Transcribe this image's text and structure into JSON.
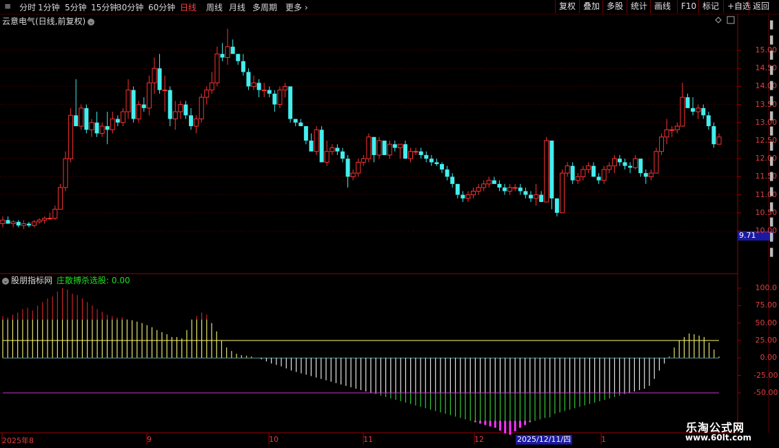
{
  "toolbar": {
    "periods": [
      "分时",
      "1分钟",
      "5分钟",
      "15分钟",
      "30分钟",
      "60分钟",
      "日线",
      "周线",
      "月线",
      "多周期",
      "更多"
    ],
    "active_period": "日线",
    "right_buttons": [
      "复权",
      "叠加",
      "多股",
      "统计",
      "画线",
      "F10",
      "标记",
      "+自选",
      "返回"
    ]
  },
  "main_chart": {
    "title": "云意电气(日线,前复权)",
    "price_tag": "9.71",
    "y_ticks": [
      "15.00",
      "14.50",
      "14.00",
      "13.50",
      "13.00",
      "12.50",
      "12.00",
      "11.50",
      "11.00",
      "10.50",
      "10.00"
    ]
  },
  "indicator": {
    "name": "股朋指标网",
    "formula_label": "庄散搏杀选股: 0.00",
    "y_ticks": [
      "100.0",
      "75.00",
      "50.00",
      "25.00",
      "0.00",
      "-25.00",
      "-50.00"
    ],
    "line_upper": 25,
    "line_lower": -50
  },
  "x_axis": {
    "labels": [
      "2025年8",
      "9",
      "10",
      "11",
      "12",
      "1"
    ],
    "cursor_date": "2025/12/11/四"
  },
  "watermark": {
    "line1": "乐淘公式网",
    "line2": "www.60lt.com"
  },
  "colors": {
    "up": "#ff3333",
    "down": "#44eeee",
    "yellow_line": "#ffff66",
    "magenta_line": "#cc33cc"
  },
  "chart_data": {
    "type": "candlestick",
    "candles": [
      [
        10.2,
        10.4,
        10.1,
        10.3
      ],
      [
        10.3,
        10.4,
        10.2,
        10.2
      ],
      [
        10.2,
        10.3,
        10.1,
        10.25
      ],
      [
        10.25,
        10.3,
        10.1,
        10.15
      ],
      [
        10.15,
        10.3,
        10.05,
        10.2
      ],
      [
        10.2,
        10.25,
        10.1,
        10.15
      ],
      [
        10.15,
        10.3,
        10.1,
        10.25
      ],
      [
        10.25,
        10.35,
        10.2,
        10.3
      ],
      [
        10.3,
        10.4,
        10.2,
        10.35
      ],
      [
        10.35,
        10.5,
        10.3,
        10.35
      ],
      [
        10.35,
        10.7,
        10.3,
        10.6
      ],
      [
        10.6,
        11.3,
        10.6,
        11.2
      ],
      [
        11.2,
        12.2,
        11.1,
        12.0
      ],
      [
        12.0,
        13.4,
        11.9,
        13.2
      ],
      [
        13.2,
        14.2,
        12.9,
        12.9
      ],
      [
        12.9,
        13.5,
        12.8,
        13.4
      ],
      [
        13.4,
        13.5,
        12.7,
        12.8
      ],
      [
        12.8,
        13.1,
        12.6,
        13.0
      ],
      [
        13.0,
        13.3,
        12.6,
        12.7
      ],
      [
        12.7,
        13.0,
        12.6,
        12.9
      ],
      [
        12.9,
        13.3,
        12.4,
        12.8
      ],
      [
        12.8,
        13.3,
        12.7,
        13.1
      ],
      [
        13.1,
        13.2,
        12.9,
        13.0
      ],
      [
        13.0,
        13.4,
        12.9,
        13.3
      ],
      [
        13.3,
        14.2,
        13.1,
        13.9
      ],
      [
        13.9,
        14.0,
        13.0,
        13.1
      ],
      [
        13.1,
        13.6,
        13.0,
        13.5
      ],
      [
        13.5,
        13.7,
        13.3,
        13.4
      ],
      [
        13.4,
        14.3,
        13.2,
        14.1
      ],
      [
        14.1,
        14.8,
        13.8,
        14.5
      ],
      [
        14.5,
        14.9,
        13.8,
        13.9
      ],
      [
        13.9,
        14.3,
        13.3,
        13.9
      ],
      [
        13.9,
        14.0,
        12.9,
        13.1
      ],
      [
        13.1,
        13.6,
        12.8,
        13.3
      ],
      [
        13.3,
        13.6,
        13.1,
        13.5
      ],
      [
        13.5,
        13.6,
        13.1,
        13.2
      ],
      [
        13.2,
        13.4,
        12.8,
        12.9
      ],
      [
        12.9,
        13.2,
        12.7,
        13.1
      ],
      [
        13.1,
        13.8,
        13.0,
        13.7
      ],
      [
        13.7,
        14.0,
        13.5,
        13.9
      ],
      [
        13.9,
        14.4,
        13.8,
        14.1
      ],
      [
        14.1,
        15.1,
        14.0,
        14.9
      ],
      [
        14.9,
        15.2,
        14.7,
        14.8
      ],
      [
        14.8,
        15.6,
        14.6,
        15.1
      ],
      [
        15.1,
        15.3,
        14.9,
        14.9
      ],
      [
        14.9,
        14.9,
        14.6,
        14.7
      ],
      [
        14.7,
        14.9,
        14.3,
        14.4
      ],
      [
        14.4,
        14.5,
        13.9,
        14.0
      ],
      [
        14.0,
        14.3,
        13.9,
        14.1
      ],
      [
        14.1,
        14.2,
        13.7,
        13.9
      ],
      [
        13.9,
        14.1,
        13.7,
        13.9
      ],
      [
        13.9,
        14.0,
        13.7,
        13.8
      ],
      [
        13.8,
        13.9,
        13.3,
        13.5
      ],
      [
        13.5,
        14.0,
        13.4,
        13.9
      ],
      [
        13.9,
        14.1,
        13.7,
        14.0
      ],
      [
        14.0,
        14.0,
        13.0,
        13.1
      ],
      [
        13.1,
        13.1,
        12.9,
        13.0
      ],
      [
        13.0,
        13.1,
        12.9,
        12.9
      ],
      [
        12.9,
        12.9,
        12.4,
        12.5
      ],
      [
        12.5,
        12.7,
        12.2,
        12.2
      ],
      [
        12.2,
        12.9,
        12.1,
        12.8
      ],
      [
        12.8,
        12.9,
        11.9,
        11.9
      ],
      [
        11.9,
        12.5,
        11.8,
        12.2
      ],
      [
        12.2,
        12.4,
        12.1,
        12.3
      ],
      [
        12.3,
        12.4,
        12.1,
        12.2
      ],
      [
        12.2,
        12.3,
        11.9,
        12.0
      ],
      [
        12.0,
        12.1,
        11.2,
        11.5
      ],
      [
        11.5,
        11.7,
        11.4,
        11.6
      ],
      [
        11.6,
        12.0,
        11.5,
        11.9
      ],
      [
        11.9,
        12.1,
        11.8,
        12.0
      ],
      [
        12.0,
        12.7,
        11.9,
        12.6
      ],
      [
        12.6,
        12.6,
        11.9,
        12.1
      ],
      [
        12.1,
        12.6,
        12.0,
        12.5
      ],
      [
        12.5,
        12.5,
        12.1,
        12.1
      ],
      [
        12.1,
        12.5,
        12.0,
        12.4
      ],
      [
        12.4,
        12.5,
        12.2,
        12.3
      ],
      [
        12.3,
        12.4,
        12.0,
        12.4
      ],
      [
        12.4,
        12.5,
        12.0,
        12.0
      ],
      [
        12.0,
        12.3,
        11.9,
        12.2
      ],
      [
        12.2,
        12.3,
        12.1,
        12.2
      ],
      [
        12.2,
        12.3,
        12.0,
        12.1
      ],
      [
        12.1,
        12.2,
        11.9,
        12.0
      ],
      [
        12.0,
        12.1,
        11.8,
        11.9
      ],
      [
        11.9,
        12.0,
        11.8,
        11.85
      ],
      [
        11.85,
        11.9,
        11.6,
        11.7
      ],
      [
        11.7,
        11.8,
        11.4,
        11.5
      ],
      [
        11.5,
        11.6,
        11.2,
        11.3
      ],
      [
        11.3,
        11.3,
        10.9,
        11.0
      ],
      [
        11.0,
        11.1,
        10.8,
        10.9
      ],
      [
        10.9,
        11.1,
        10.8,
        11.0
      ],
      [
        11.0,
        11.2,
        10.9,
        11.1
      ],
      [
        11.1,
        11.3,
        11.0,
        11.2
      ],
      [
        11.2,
        11.4,
        11.1,
        11.3
      ],
      [
        11.3,
        11.5,
        11.2,
        11.4
      ],
      [
        11.4,
        11.5,
        11.3,
        11.3
      ],
      [
        11.3,
        11.4,
        11.1,
        11.2
      ],
      [
        11.2,
        11.3,
        11.0,
        11.1
      ],
      [
        11.1,
        11.3,
        11.0,
        11.2
      ],
      [
        11.2,
        11.3,
        11.1,
        11.2
      ],
      [
        11.2,
        11.3,
        11.0,
        11.1
      ],
      [
        11.1,
        11.2,
        10.9,
        11.0
      ],
      [
        11.0,
        11.1,
        10.8,
        10.9
      ],
      [
        10.9,
        11.3,
        10.7,
        11.0
      ],
      [
        11.0,
        11.1,
        10.8,
        10.8
      ],
      [
        10.8,
        12.6,
        10.8,
        12.5
      ],
      [
        12.5,
        12.5,
        10.6,
        10.9
      ],
      [
        10.9,
        10.9,
        10.4,
        10.5
      ],
      [
        10.5,
        11.7,
        10.5,
        11.6
      ],
      [
        11.6,
        11.9,
        11.5,
        11.8
      ],
      [
        11.8,
        11.9,
        11.3,
        11.4
      ],
      [
        11.4,
        11.6,
        11.3,
        11.5
      ],
      [
        11.5,
        11.8,
        11.4,
        11.7
      ],
      [
        11.7,
        11.9,
        11.6,
        11.8
      ],
      [
        11.8,
        11.9,
        11.5,
        11.5
      ],
      [
        11.5,
        11.6,
        11.3,
        11.4
      ],
      [
        11.4,
        11.8,
        11.3,
        11.7
      ],
      [
        11.7,
        11.9,
        11.6,
        11.8
      ],
      [
        11.8,
        12.1,
        11.6,
        12.0
      ],
      [
        12.0,
        12.1,
        11.8,
        11.9
      ],
      [
        11.9,
        12.0,
        11.7,
        11.8
      ],
      [
        11.8,
        11.9,
        11.6,
        11.75
      ],
      [
        11.75,
        12.1,
        11.7,
        12.0
      ],
      [
        12.0,
        12.0,
        11.5,
        11.6
      ],
      [
        11.6,
        11.7,
        11.3,
        11.5
      ],
      [
        11.5,
        11.7,
        11.4,
        11.6
      ],
      [
        11.6,
        12.3,
        11.6,
        12.2
      ],
      [
        12.2,
        12.7,
        12.1,
        12.6
      ],
      [
        12.6,
        13.1,
        12.4,
        12.8
      ],
      [
        12.8,
        12.9,
        12.6,
        12.8
      ],
      [
        12.8,
        13.0,
        12.7,
        12.9
      ],
      [
        12.9,
        14.1,
        12.9,
        13.7
      ],
      [
        13.7,
        13.8,
        13.4,
        13.4
      ],
      [
        13.4,
        13.7,
        13.2,
        13.3
      ],
      [
        13.3,
        13.5,
        13.1,
        13.4
      ],
      [
        13.4,
        13.5,
        13.1,
        13.2
      ],
      [
        13.2,
        13.3,
        12.8,
        12.9
      ],
      [
        12.9,
        13.0,
        12.3,
        12.4
      ],
      [
        12.4,
        12.7,
        12.4,
        12.6
      ]
    ],
    "indicator_values": [
      60,
      58,
      62,
      65,
      70,
      72,
      68,
      75,
      80,
      85,
      88,
      95,
      100,
      98,
      92,
      90,
      85,
      80,
      75,
      70,
      66,
      62,
      60,
      58,
      58,
      55,
      54,
      52,
      50,
      47,
      44,
      40,
      37,
      34,
      30,
      30,
      28,
      40,
      55,
      60,
      65,
      62,
      50,
      38,
      25,
      15,
      10,
      6,
      4,
      3,
      2,
      0,
      -2,
      -5,
      -8,
      -10,
      -12,
      -15,
      -18,
      -20,
      -22,
      -24,
      -26,
      -28,
      -30,
      -32,
      -34,
      -36,
      -38,
      -40,
      -42,
      -44,
      -46,
      -48,
      -50,
      -52,
      -54,
      -56,
      -58,
      -60,
      -62,
      -64,
      -66,
      -68,
      -70,
      -72,
      -74,
      -76,
      -78,
      -80,
      -82,
      -84,
      -86,
      -88,
      -90,
      -92,
      -94,
      -96,
      -98,
      -100,
      -104,
      -108,
      -110,
      -105,
      -100,
      -96,
      -92,
      -90,
      -88,
      -86,
      -85,
      -80,
      -78,
      -76,
      -74,
      -72,
      -70,
      -68,
      -66,
      -64,
      -62,
      -60,
      -58,
      -56,
      -54,
      -52,
      -50,
      -48,
      -46,
      -44,
      -40,
      -30,
      -18,
      -8,
      2,
      15,
      25,
      30,
      35,
      34,
      32,
      30,
      22,
      12,
      2
    ]
  }
}
